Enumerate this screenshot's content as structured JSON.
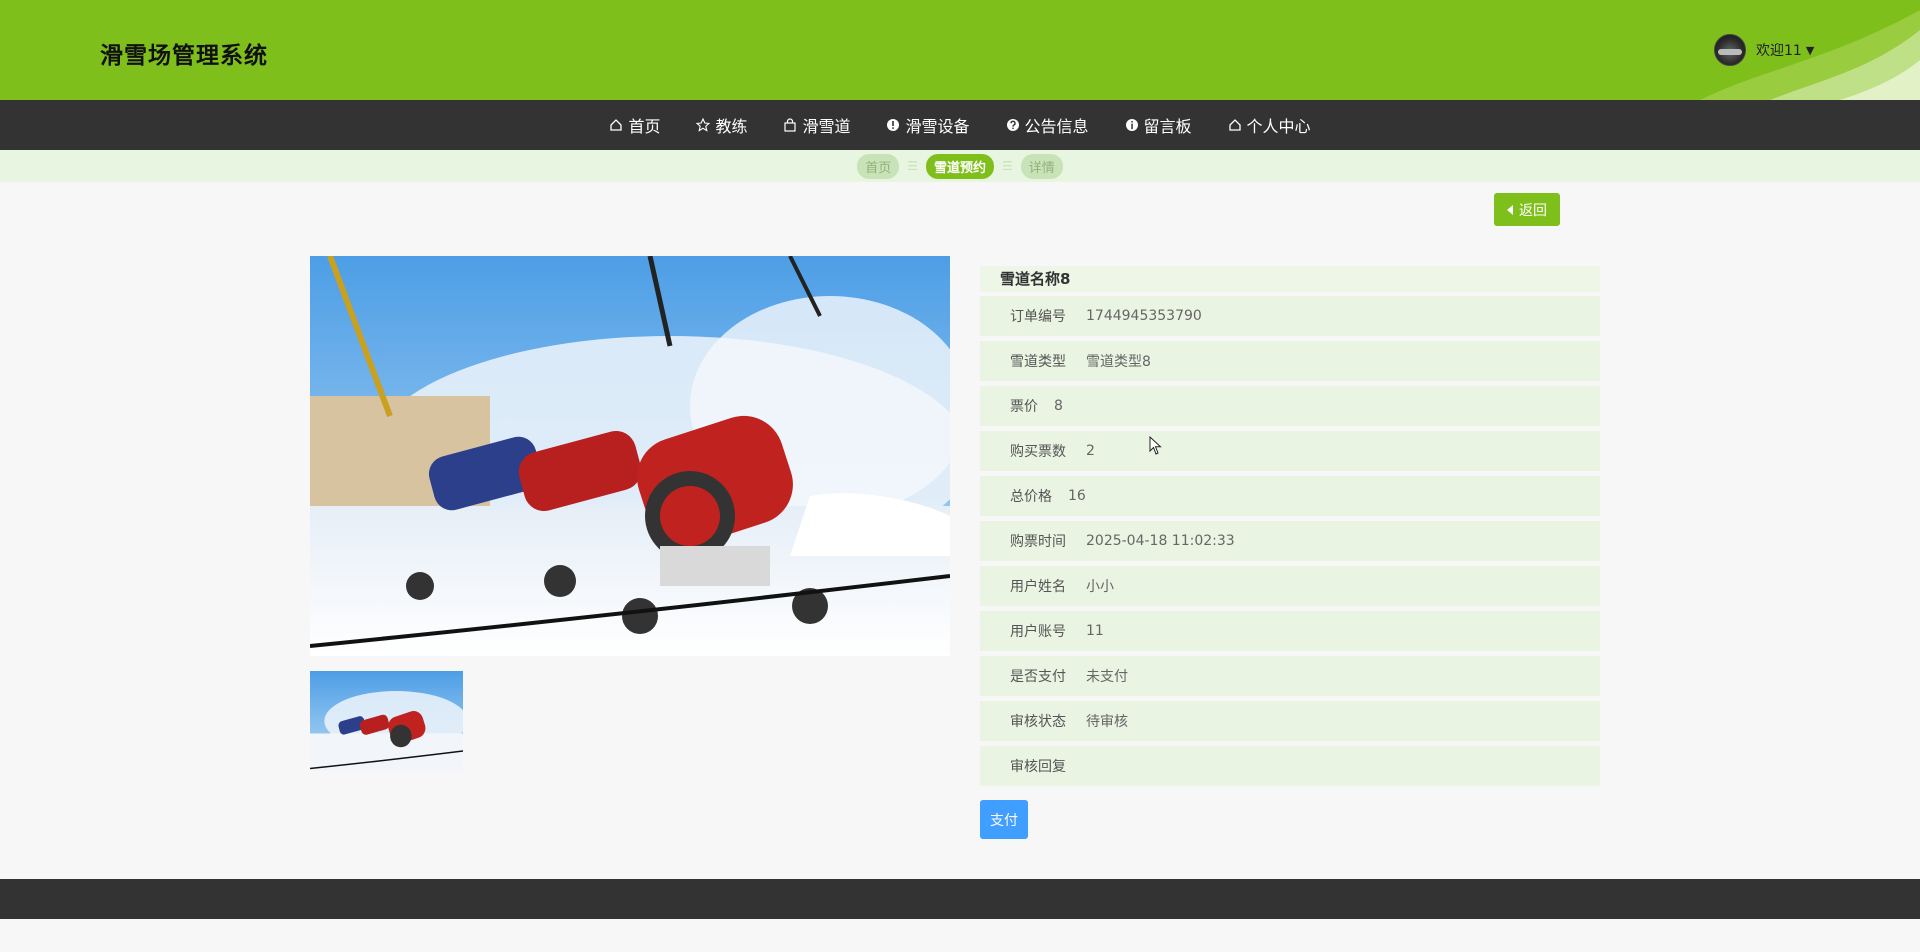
{
  "header": {
    "site_title": "滑雪场管理系统",
    "welcome": "欢迎11",
    "caret": "▼"
  },
  "nav": [
    {
      "label": "首页",
      "icon": "home-icon"
    },
    {
      "label": "教练",
      "icon": "star-icon"
    },
    {
      "label": "滑雪道",
      "icon": "bag-icon"
    },
    {
      "label": "滑雪设备",
      "icon": "alert-icon"
    },
    {
      "label": "公告信息",
      "icon": "question-icon"
    },
    {
      "label": "留言板",
      "icon": "info-icon"
    },
    {
      "label": "个人中心",
      "icon": "home-icon"
    }
  ],
  "breadcrumb": {
    "items": [
      "首页",
      "雪道预约",
      "详情"
    ],
    "separator": "☰"
  },
  "back_label": "返回",
  "detail": {
    "title": "雪道名称8",
    "fields": [
      {
        "label": "订单编号",
        "value": "1744945353790"
      },
      {
        "label": "雪道类型",
        "value": "雪道类型8"
      },
      {
        "label": "票价",
        "value": "8"
      },
      {
        "label": "购买票数",
        "value": "2"
      },
      {
        "label": "总价格",
        "value": "16"
      },
      {
        "label": "购票时间",
        "value": "2025-04-18 11:02:33"
      },
      {
        "label": "用户姓名",
        "value": "小小"
      },
      {
        "label": "用户账号",
        "value": "11"
      },
      {
        "label": "是否支付",
        "value": "未支付"
      },
      {
        "label": "审核状态",
        "value": "待审核"
      },
      {
        "label": "审核回复",
        "value": ""
      }
    ]
  },
  "pay_label": "支付",
  "colors": {
    "brand_green": "#7fbf1c",
    "nav_dark": "#333333",
    "row_bg": "#e9f4e2",
    "pay_blue": "#409eff"
  }
}
